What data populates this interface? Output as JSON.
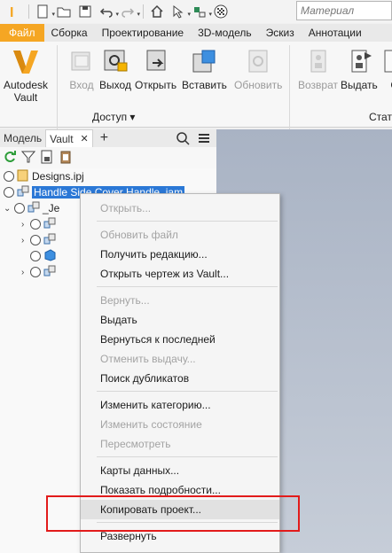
{
  "quick_access": {
    "icons": [
      "inventor-logo-icon",
      "new-file-icon",
      "open-folder-icon",
      "save-icon",
      "undo-icon",
      "redo-icon",
      "home-icon",
      "select-icon",
      "measure-icon",
      "appearance-icon"
    ],
    "material_placeholder": "Материал"
  },
  "ribbon_tabs": [
    "Файл",
    "Сборка",
    "Проектирование",
    "3D-модель",
    "Эскиз",
    "Аннотации"
  ],
  "ribbon": {
    "vault_button": "Autodesk\nVault",
    "buttons": [
      {
        "label": "Вход",
        "disabled": true,
        "icon": "checkin-icon"
      },
      {
        "label": "Выход",
        "disabled": false,
        "icon": "checkout-icon"
      },
      {
        "label": "Открыть",
        "disabled": false,
        "icon": "open-icon"
      },
      {
        "label": "Вставить",
        "disabled": false,
        "icon": "insert-icon"
      },
      {
        "label": "Обновить",
        "disabled": true,
        "icon": "refresh-icon"
      },
      {
        "label": "Возврат",
        "disabled": true,
        "icon": "undo-checkout-icon"
      },
      {
        "label": "Выдать",
        "disabled": false,
        "icon": "release-icon"
      },
      {
        "label": "Со",
        "disabled": false,
        "icon": "status-icon"
      }
    ],
    "group_access": "Доступ ▾",
    "group_status": "Стату"
  },
  "browser": {
    "tabs": [
      "Модель",
      "Vault"
    ],
    "close_glyph": "✕",
    "add_glyph": "+",
    "tree": [
      {
        "label": "Designs.ipj"
      },
      {
        "label": "Handle Side Cover Handle .iam"
      },
      {
        "label": "_Je"
      }
    ]
  },
  "menu": {
    "items": [
      {
        "label": "Открыть...",
        "disabled": true
      },
      {
        "separator": true
      },
      {
        "label": "Обновить файл",
        "disabled": true
      },
      {
        "label": "Получить редакцию...",
        "disabled": false
      },
      {
        "label": "Открыть чертеж из Vault...",
        "disabled": false
      },
      {
        "separator": true
      },
      {
        "label": "Вернуть...",
        "disabled": true
      },
      {
        "label": "Выдать",
        "disabled": false
      },
      {
        "label": "Вернуться к последней",
        "disabled": false
      },
      {
        "label": "Отменить выдачу...",
        "disabled": true
      },
      {
        "label": "Поиск дубликатов",
        "disabled": false
      },
      {
        "separator": true
      },
      {
        "label": "Изменить категорию...",
        "disabled": false
      },
      {
        "label": "Изменить состояние",
        "disabled": true
      },
      {
        "label": "Пересмотреть",
        "disabled": true
      },
      {
        "separator": true
      },
      {
        "label": "Карты данных...",
        "disabled": false
      },
      {
        "label": "Показать подробности...",
        "disabled": false
      },
      {
        "label": "Копировать проект...",
        "disabled": false,
        "hover": true
      },
      {
        "separator": true
      },
      {
        "label": "Развернуть",
        "disabled": false
      }
    ]
  },
  "colors": {
    "file_tab": "#f5a623",
    "selection": "#2b78d6",
    "highlight_box": "#e21b1b"
  }
}
